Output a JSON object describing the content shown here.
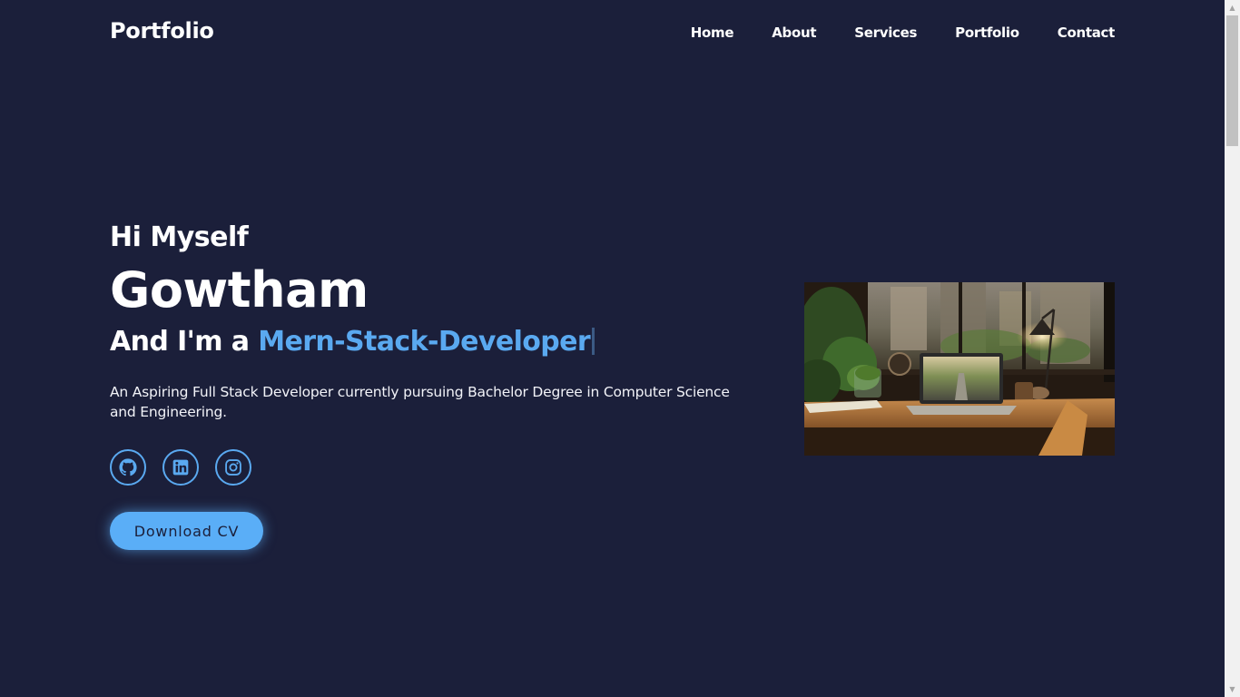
{
  "header": {
    "logo": "Portfolio",
    "nav": [
      {
        "label": "Home"
      },
      {
        "label": "About"
      },
      {
        "label": "Services"
      },
      {
        "label": "Portfolio"
      },
      {
        "label": "Contact"
      }
    ]
  },
  "hero": {
    "greeting": "Hi Myself",
    "name": "Gowtham",
    "role_prefix": "And I'm a ",
    "role_highlight": "Mern-Stack-Developer",
    "description": "An Aspiring Full Stack Developer currently pursuing Bachelor Degree in Computer Science and Engineering.",
    "socials": [
      {
        "icon": "github-icon"
      },
      {
        "icon": "linkedin-icon"
      },
      {
        "icon": "instagram-icon"
      }
    ],
    "cv_button": "Download CV"
  },
  "colors": {
    "background": "#1b1f3a",
    "accent": "#5aa9f0",
    "text": "#ffffff"
  }
}
